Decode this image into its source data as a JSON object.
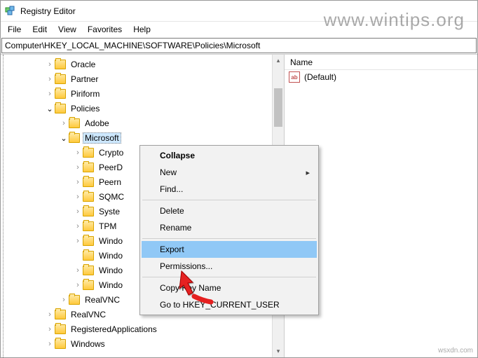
{
  "window": {
    "title": "Registry Editor"
  },
  "menubar": [
    "File",
    "Edit",
    "View",
    "Favorites",
    "Help"
  ],
  "address": "Computer\\HKEY_LOCAL_MACHINE\\SOFTWARE\\Policies\\Microsoft",
  "tree": {
    "items": [
      {
        "indent": 55,
        "expander": ">",
        "label": "Oracle"
      },
      {
        "indent": 55,
        "expander": ">",
        "label": "Partner"
      },
      {
        "indent": 55,
        "expander": ">",
        "label": "Piriform"
      },
      {
        "indent": 55,
        "expander": "v",
        "label": "Policies",
        "expanded": true
      },
      {
        "indent": 75,
        "expander": ">",
        "label": "Adobe"
      },
      {
        "indent": 75,
        "expander": "v",
        "label": "Microsoft",
        "expanded": true,
        "selected": true
      },
      {
        "indent": 95,
        "expander": ">",
        "label": "Crypto"
      },
      {
        "indent": 95,
        "expander": ">",
        "label": "PeerD"
      },
      {
        "indent": 95,
        "expander": ">",
        "label": "Peern"
      },
      {
        "indent": 95,
        "expander": ">",
        "label": "SQMC"
      },
      {
        "indent": 95,
        "expander": ">",
        "label": "Syste"
      },
      {
        "indent": 95,
        "expander": ">",
        "label": "TPM"
      },
      {
        "indent": 95,
        "expander": ">",
        "label": "Windo"
      },
      {
        "indent": 95,
        "expander": "",
        "label": "Windo"
      },
      {
        "indent": 95,
        "expander": ">",
        "label": "Windo"
      },
      {
        "indent": 95,
        "expander": ">",
        "label": "Windo"
      },
      {
        "indent": 75,
        "expander": ">",
        "label": "RealVNC"
      },
      {
        "indent": 55,
        "expander": ">",
        "label": "RealVNC"
      },
      {
        "indent": 55,
        "expander": ">",
        "label": "RegisteredApplications"
      },
      {
        "indent": 55,
        "expander": ">",
        "label": "Windows"
      }
    ]
  },
  "values": {
    "header": "Name",
    "default_label": "(Default)"
  },
  "contextMenu": {
    "items": [
      {
        "label": "Collapse",
        "bold": true
      },
      {
        "label": "New",
        "submenu": true
      },
      {
        "label": "Find..."
      },
      {
        "sep": true
      },
      {
        "label": "Delete"
      },
      {
        "label": "Rename"
      },
      {
        "sep": true
      },
      {
        "label": "Export",
        "highlight": true
      },
      {
        "label": "Permissions..."
      },
      {
        "sep": true
      },
      {
        "label": "Copy Key Name"
      },
      {
        "label": "Go to HKEY_CURRENT_USER"
      }
    ]
  },
  "watermark": "www.wintips.org",
  "attribution": "wsxdn.com"
}
